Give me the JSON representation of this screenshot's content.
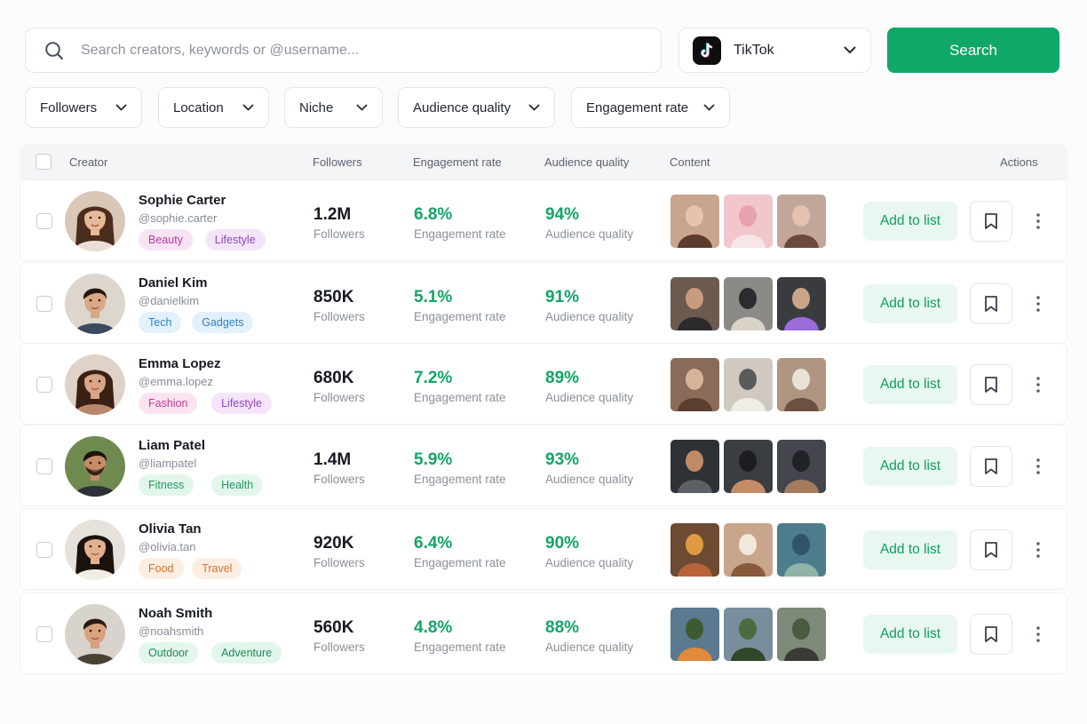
{
  "search": {
    "placeholder": "Search creators, keywords or @username...",
    "icon": "search-icon"
  },
  "platform": {
    "label": "TikTok",
    "icon": "tiktok-logo"
  },
  "search_button": "Search",
  "filters": [
    "Followers",
    "Location",
    "Niche",
    "Audience quality",
    "Engagement rate"
  ],
  "table": {
    "headers": {
      "creator": "Creator",
      "followers": "Followers",
      "engagement": "Engagement rate",
      "quality": "Audience quality",
      "content": "Content",
      "actions": "Actions"
    },
    "rows": [
      {
        "name": "Sophie Carter",
        "handle": "@sophie.carter",
        "tags": [
          {
            "label": "Beauty",
            "color": "#f8e3f4",
            "text": "#b43ca0"
          },
          {
            "label": "Lifestyle",
            "color": "#f3e6fb",
            "text": "#9245c2"
          }
        ],
        "followers": "1.2M",
        "followers_label": "Followers",
        "engagement": "6.8%",
        "engagement_label": "Engagement rate",
        "quality": "94%",
        "quality_label": "Audience quality",
        "add_label": "Add to list"
      },
      {
        "name": "Daniel Kim",
        "handle": "@danielkim",
        "tags": [
          {
            "label": "Tech",
            "color": "#e3f1fc",
            "text": "#2f81c4"
          },
          {
            "label": "Gadgets",
            "color": "#e3f1fc",
            "text": "#2f81c4"
          }
        ],
        "followers": "850K",
        "followers_label": "Followers",
        "engagement": "5.1%",
        "engagement_label": "Engagement rate",
        "quality": "91%",
        "quality_label": "Audience quality",
        "add_label": "Add to list"
      },
      {
        "name": "Emma Lopez",
        "handle": "@emma.lopez",
        "tags": [
          {
            "label": "Fashion",
            "color": "#fbe3f2",
            "text": "#c03c8f"
          },
          {
            "label": "Lifestyle",
            "color": "#f4e5fb",
            "text": "#9245c2"
          }
        ],
        "followers": "680K",
        "followers_label": "Followers",
        "engagement": "7.2%",
        "engagement_label": "Engagement rate",
        "quality": "89%",
        "quality_label": "Audience quality",
        "add_label": "Add to list"
      },
      {
        "name": "Liam Patel",
        "handle": "@liampatel",
        "tags": [
          {
            "label": "Fitness",
            "color": "#e3f6ec",
            "text": "#1f9a5e"
          },
          {
            "label": "Health",
            "color": "#e3f6ec",
            "text": "#1f9a5e"
          }
        ],
        "followers": "1.4M",
        "followers_label": "Followers",
        "engagement": "5.9%",
        "engagement_label": "Engagement rate",
        "quality": "93%",
        "quality_label": "Audience quality",
        "add_label": "Add to list"
      },
      {
        "name": "Olivia Tan",
        "handle": "@olivia.tan",
        "tags": [
          {
            "label": "Food",
            "color": "#fdeee1",
            "text": "#d3722f"
          },
          {
            "label": "Travel",
            "color": "#fdeee1",
            "text": "#d3722f"
          }
        ],
        "followers": "920K",
        "followers_label": "Followers",
        "engagement": "6.4%",
        "engagement_label": "Engagement rate",
        "quality": "90%",
        "quality_label": "Audience quality",
        "add_label": "Add to list"
      },
      {
        "name": "Noah Smith",
        "handle": "@noahsmith",
        "tags": [
          {
            "label": "Outdoor",
            "color": "#e3f6ec",
            "text": "#1f8a55"
          },
          {
            "label": "Adventure",
            "color": "#e3f6ec",
            "text": "#1f8a55"
          }
        ],
        "followers": "560K",
        "followers_label": "Followers",
        "engagement": "4.8%",
        "engagement_label": "Engagement rate",
        "quality": "88%",
        "quality_label": "Audience quality",
        "add_label": "Add to list"
      }
    ]
  },
  "colors": {
    "accent": "#0fa868",
    "accent_text": "#0f9f60",
    "add_bg": "#e8f7ef",
    "header_bg": "#f4f5f7",
    "value_green": "#12a565"
  }
}
